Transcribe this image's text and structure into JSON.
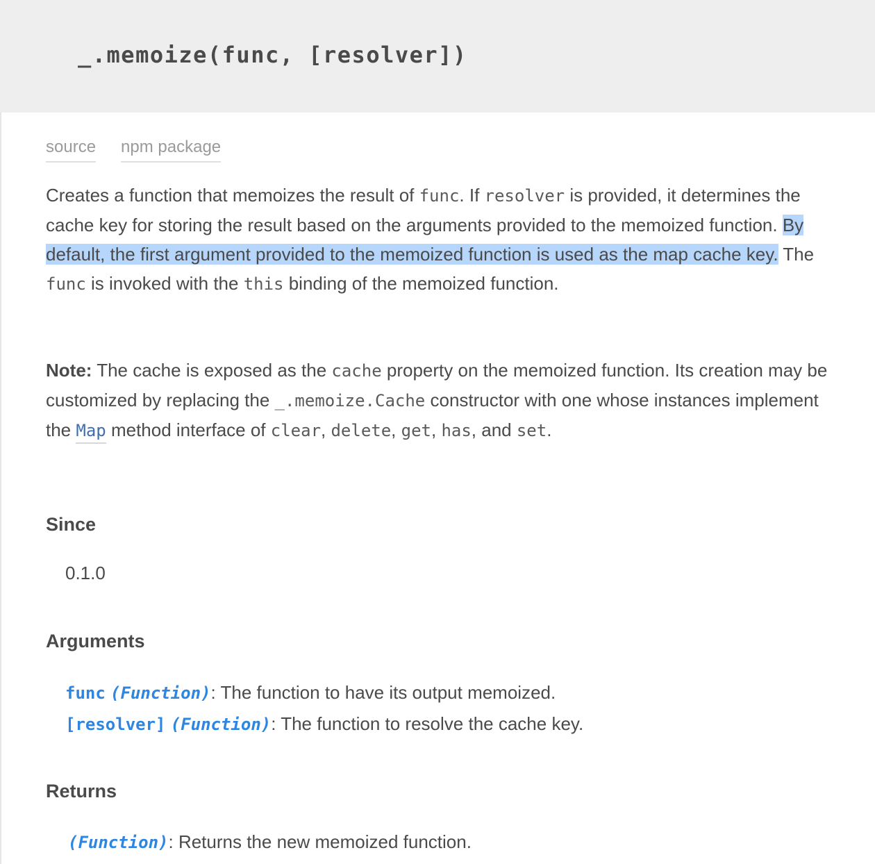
{
  "header": {
    "signature": "_.memoize(func, [resolver])"
  },
  "links": {
    "source": "source",
    "npm": "npm package"
  },
  "description": {
    "t1": "Creates a function that memoizes the result of ",
    "c1": "func",
    "t2": ". If ",
    "c2": "resolver",
    "t3": " is provided, it determines the cache key for storing the result based on the arguments provided to the memoized function. ",
    "highlight": "By default, the first argument provided to the memoized function is used as the map cache key.",
    "t4": " The ",
    "c3": "func",
    "t5": " is invoked with the ",
    "c4": "this",
    "t6": " binding of the memoized function."
  },
  "note": {
    "label": "Note:",
    "t1": " The cache is exposed as the ",
    "c1": "cache",
    "t2": " property on the memoized function. Its creation may be customized by replacing the ",
    "c2": "_.memoize.Cache",
    "t3": " constructor with one whose instances implement the ",
    "map_link": "Map",
    "t4": " method interface of ",
    "c3": "clear",
    "sep1": ", ",
    "c4": "delete",
    "sep2": ", ",
    "c5": "get",
    "sep3": ", ",
    "c6": "has",
    "t5": ", and ",
    "c7": "set",
    "t6": "."
  },
  "since": {
    "heading": "Since",
    "version": "0.1.0"
  },
  "arguments": {
    "heading": "Arguments",
    "items": [
      {
        "name": "func",
        "type": "(Function)",
        "desc": ": The function to have its output memoized."
      },
      {
        "name": "[resolver]",
        "type": "(Function)",
        "desc": ": The function to resolve the cache key."
      }
    ]
  },
  "returns": {
    "heading": "Returns",
    "type": "(Function)",
    "desc": ": Returns the new memoized function."
  }
}
